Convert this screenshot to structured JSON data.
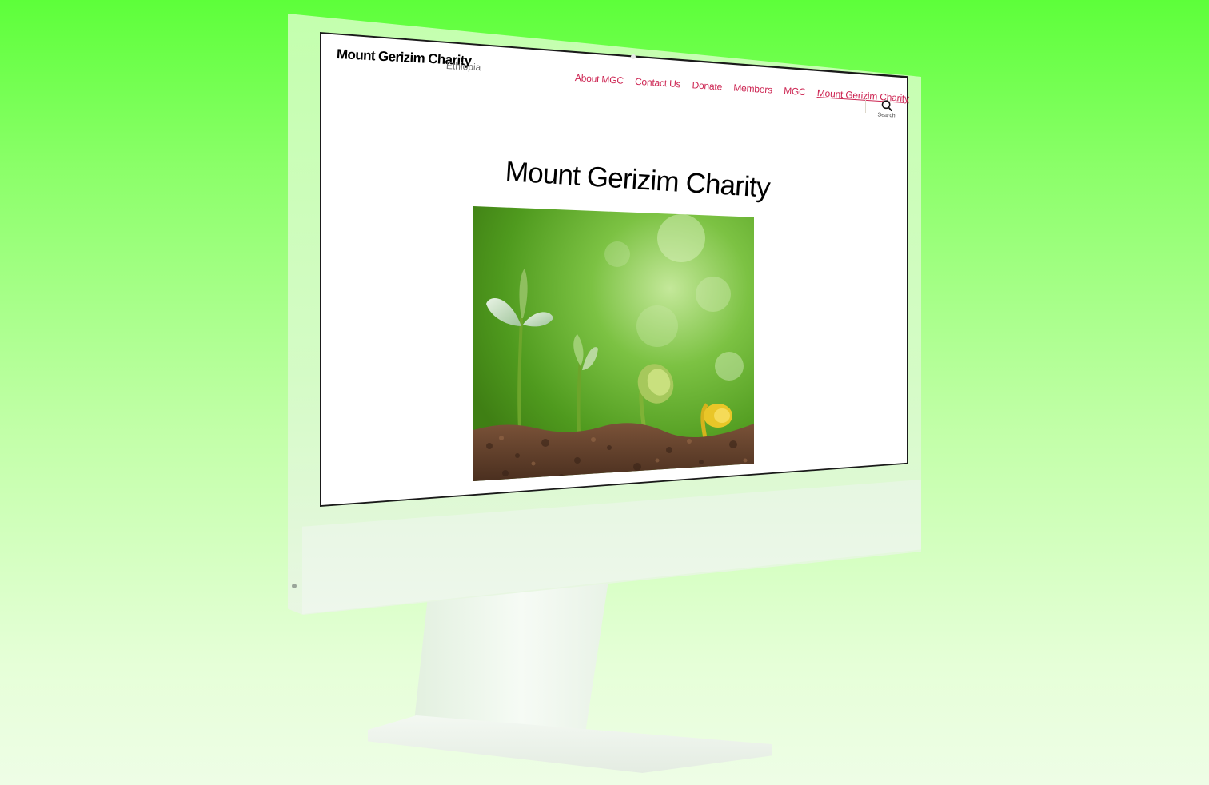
{
  "site": {
    "title": "Mount Gerizim Charity",
    "tagline": "Ethiopia"
  },
  "nav": {
    "items": [
      {
        "label": "About MGC",
        "current": false
      },
      {
        "label": "Contact Us",
        "current": false
      },
      {
        "label": "Donate",
        "current": false
      },
      {
        "label": "Members",
        "current": false
      },
      {
        "label": "MGC",
        "current": false
      },
      {
        "label": "Mount Gerizim Charity",
        "current": true
      }
    ],
    "link_color": "#cd2653"
  },
  "search": {
    "label": "Search",
    "icon": "search-icon"
  },
  "page": {
    "heading": "Mount Gerizim Charity",
    "featured_image": "seedlings-in-soil"
  },
  "colors": {
    "background_top": "#5dff3a",
    "background_bottom": "#eefde6",
    "screen_background": "#ffffff"
  }
}
